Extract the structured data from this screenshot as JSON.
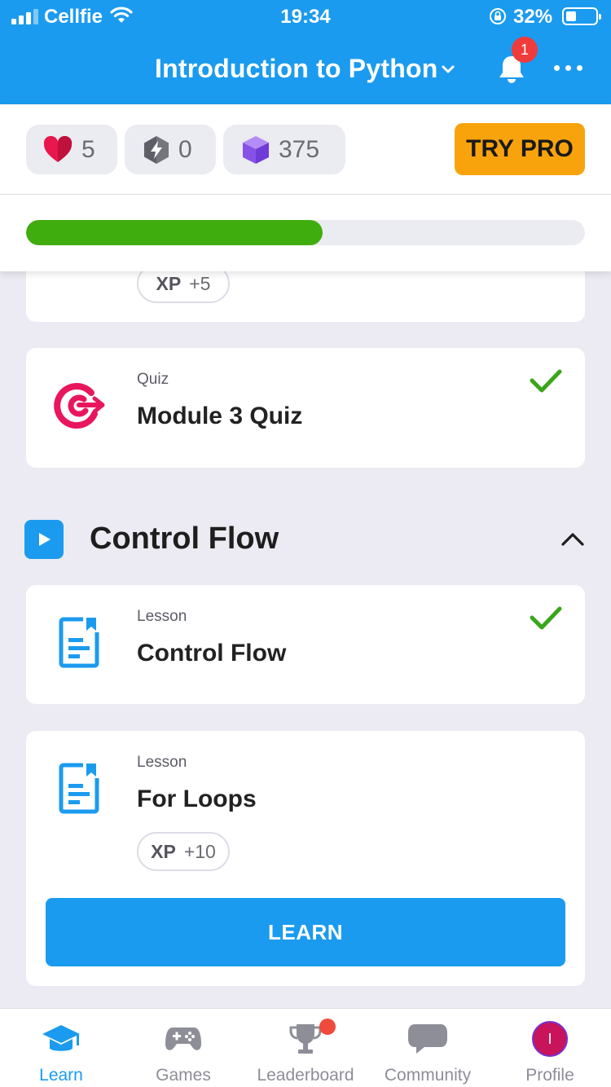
{
  "status_bar": {
    "carrier": "Cellfie",
    "time": "19:34",
    "battery": "32%"
  },
  "header": {
    "title": "Introduction to Python",
    "notifications_count": "1"
  },
  "stats": {
    "hearts": "5",
    "bolts": "0",
    "gems": "375",
    "try_pro_label": "TRY PRO",
    "progress_fraction": 0.53
  },
  "cards": {
    "previous": {
      "xp_label": "XP",
      "xp_value": "+5"
    },
    "quiz": {
      "type": "Quiz",
      "title": "Module 3 Quiz",
      "completed": true
    },
    "lesson_control_flow": {
      "type": "Lesson",
      "title": "Control Flow",
      "completed": true
    },
    "lesson_for_loops": {
      "type": "Lesson",
      "title": "For Loops",
      "xp_label": "XP",
      "xp_value": "+10",
      "button_label": "LEARN"
    }
  },
  "section": {
    "title": "Control Flow"
  },
  "bottom_nav": {
    "items": [
      {
        "label": "Learn",
        "icon": "graduation-cap-icon",
        "active": true
      },
      {
        "label": "Games",
        "icon": "gamepad-icon"
      },
      {
        "label": "Leaderboard",
        "icon": "trophy-icon"
      },
      {
        "label": "Community",
        "icon": "chat-bubble-icon"
      },
      {
        "label": "Profile",
        "icon": "avatar"
      }
    ],
    "profile_initial": "I"
  },
  "colors": {
    "brand_blue": "#1b9bef",
    "pro_orange": "#f9a30c",
    "progress_green": "#3fad0e",
    "check_green": "#3aa51b",
    "quiz_pink": "#e8175d",
    "badge_red": "#ef3b3b"
  }
}
